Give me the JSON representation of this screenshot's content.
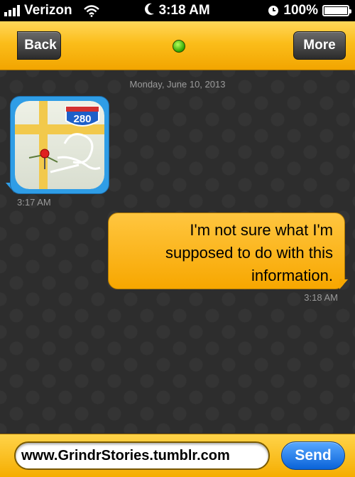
{
  "status_bar": {
    "carrier": "Verizon",
    "time": "3:18 AM",
    "battery": "100%"
  },
  "nav": {
    "back_label": "Back",
    "more_label": "More",
    "online_color": "#3ec800"
  },
  "chat": {
    "date": "Monday, June 10, 2013",
    "messages": [
      {
        "direction": "incoming",
        "type": "map-image",
        "map_route_label": "280",
        "time": "3:17 AM"
      },
      {
        "direction": "outgoing",
        "type": "text",
        "text": "I'm not sure what I'm supposed to do with this information.",
        "time": "3:18 AM"
      }
    ]
  },
  "compose": {
    "value": "www.GrindrStories.tumblr.com",
    "send_label": "Send"
  },
  "colors": {
    "accent": "#fbbd1a",
    "incoming_bubble": "#2f9de6",
    "send_button": "#1f7ef0"
  }
}
